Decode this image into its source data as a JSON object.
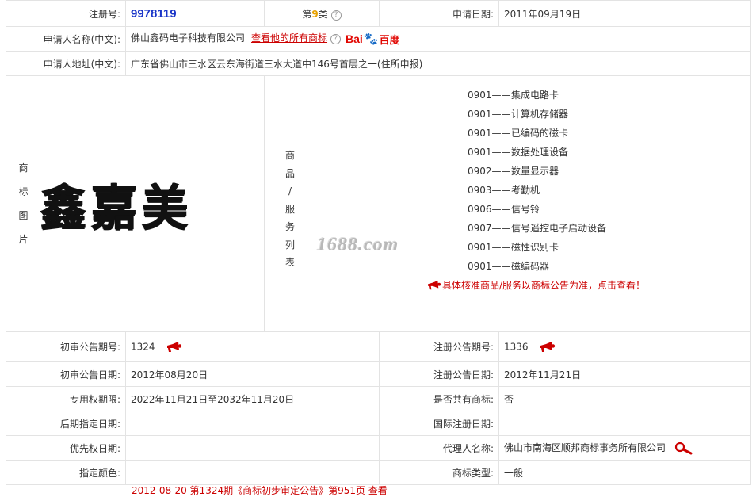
{
  "reg_no": {
    "label": "注册号:",
    "value": "9978119"
  },
  "class": {
    "prefix": "第",
    "number": "9",
    "suffix": "类"
  },
  "apply_date": {
    "label": "申请日期:",
    "value": "2011年09月19日"
  },
  "applicant": {
    "label": "申请人名称(中文):",
    "value": "佛山鑫码电子科技有限公司",
    "all_marks_link": "查看他的所有商标",
    "baidu_text_a": "Bai",
    "baidu_text_b": "百度"
  },
  "address": {
    "label": "申请人地址(中文):",
    "value": "广东省佛山市三水区云东海街道三水大道中146号首层之一(住所申报)"
  },
  "image_label_chars": [
    "商",
    "标",
    "图",
    "片"
  ],
  "trademark_text": "鑫嘉美",
  "watermark": "1688.com",
  "service_label_chars": [
    "商",
    "品",
    "/",
    "服",
    "务",
    "列",
    "表"
  ],
  "services": [
    {
      "code": "0901——",
      "name": "集成电路卡"
    },
    {
      "code": "0901——",
      "name": "计算机存储器"
    },
    {
      "code": "0901——",
      "name": "已编码的磁卡"
    },
    {
      "code": "0901——",
      "name": "数据处理设备"
    },
    {
      "code": "0902——",
      "name": "数量显示器"
    },
    {
      "code": "0903——",
      "name": "考勤机"
    },
    {
      "code": "0906——",
      "name": "信号铃"
    },
    {
      "code": "0907——",
      "name": "信号遥控电子启动设备"
    },
    {
      "code": "0901——",
      "name": "磁性识别卡"
    },
    {
      "code": "0901——",
      "name": "磁编码器"
    }
  ],
  "services_notice": "具体核准商品/服务以商标公告为准，点击查看！",
  "rows": {
    "prelim_issue": {
      "label": "初审公告期号:",
      "value": "1324"
    },
    "reg_issue": {
      "label": "注册公告期号:",
      "value": "1336"
    },
    "prelim_date": {
      "label": "初审公告日期:",
      "value": "2012年08月20日"
    },
    "reg_date": {
      "label": "注册公告日期:",
      "value": "2012年11月21日"
    },
    "exclusive_period": {
      "label": "专用权期限:",
      "value": "2022年11月21日至2032年11月20日"
    },
    "shared": {
      "label": "是否共有商标:",
      "value": "否"
    },
    "later_designation": {
      "label": "后期指定日期:",
      "value": ""
    },
    "intl_reg_date": {
      "label": "国际注册日期:",
      "value": ""
    },
    "priority_date": {
      "label": "优先权日期:",
      "value": ""
    },
    "agent": {
      "label": "代理人名称:",
      "value": "佛山市南海区顺邦商标事务所有限公司"
    },
    "color": {
      "label": "指定颜色:",
      "value": ""
    },
    "mark_type": {
      "label": "商标类型:",
      "value": "一般"
    }
  },
  "bottom_partial": "2012-08-20 第1324期《商标初步审定公告》第951页 查看",
  "colors": {
    "border": "#e3e3e3",
    "reg_no": "#1a35c8",
    "red": "#cc0000",
    "class_num": "#e8a200"
  }
}
